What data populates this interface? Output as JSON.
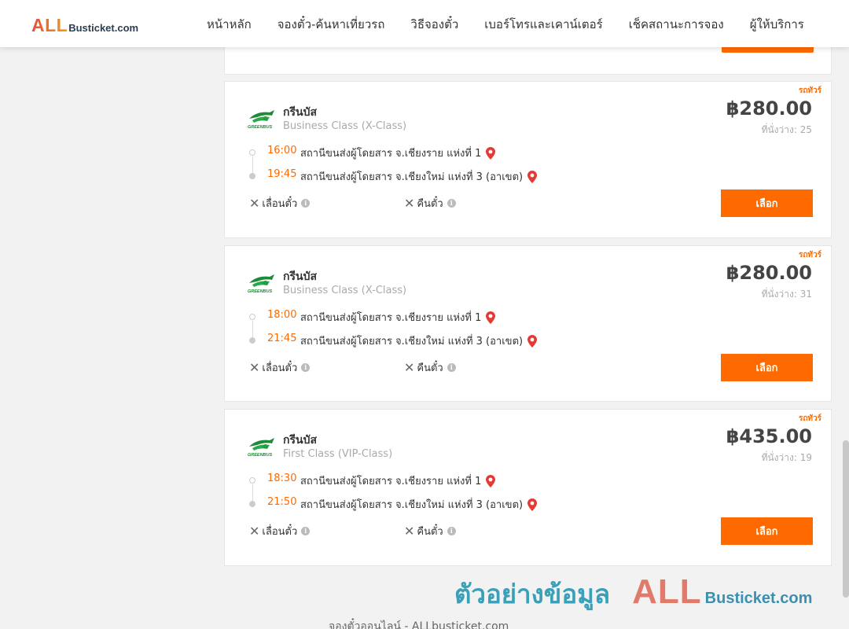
{
  "header": {
    "logo": {
      "all": "ALL",
      "rest": "Busticket.com"
    },
    "nav": [
      "หน้าหลัก",
      "จองตั๋ว-ค้นหาเที่ยวรถ",
      "วิธีจองตั๋ว",
      "เบอร์โทรและเคาน์เตอร์",
      "เช็คสถานะการจอง",
      "ผู้ให้บริการ"
    ]
  },
  "colors": {
    "accent": "#ff6a00",
    "logo_all_gradient": [
      "#e74c3c",
      "#f39c12"
    ],
    "text_muted": "#aaaaaa"
  },
  "trips": [
    {
      "tag": "รถทัวร์",
      "operator": "กรีนบัส",
      "bus_class": "Business Class (X-Class)",
      "price": "฿280.00",
      "seats": "ที่นั่งว่าง: 25",
      "depart_time": "16:00",
      "depart_station": "สถานีขนส่งผู้โดยสาร จ.เชียงราย แห่งที่ 1",
      "arrive_time": "19:45",
      "arrive_station": "สถานีขนส่งผู้โดยสาร จ.เชียงใหม่ แห่งที่ 3 (อาเขต)",
      "reschedule": "เลื่อนตั๋ว",
      "refund": "คืนตั๋ว",
      "select": "เลือก"
    },
    {
      "tag": "รถทัวร์",
      "operator": "กรีนบัส",
      "bus_class": "Business Class (X-Class)",
      "price": "฿280.00",
      "seats": "ที่นั่งว่าง: 31",
      "depart_time": "18:00",
      "depart_station": "สถานีขนส่งผู้โดยสาร จ.เชียงราย แห่งที่ 1",
      "arrive_time": "21:45",
      "arrive_station": "สถานีขนส่งผู้โดยสาร จ.เชียงใหม่ แห่งที่ 3 (อาเขต)",
      "reschedule": "เลื่อนตั๋ว",
      "refund": "คืนตั๋ว",
      "select": "เลือก"
    },
    {
      "tag": "รถทัวร์",
      "operator": "กรีนบัส",
      "bus_class": "First Class (VIP-Class)",
      "price": "฿435.00",
      "seats": "ที่นั่งว่าง: 19",
      "depart_time": "18:30",
      "depart_station": "สถานีขนส่งผู้โดยสาร จ.เชียงราย แห่งที่ 1",
      "arrive_time": "21:50",
      "arrive_station": "สถานีขนส่งผู้โดยสาร จ.เชียงใหม่ แห่งที่ 3 (อาเขต)",
      "reschedule": "เลื่อนตั๋ว",
      "refund": "คืนตั๋ว",
      "select": "เลือก"
    }
  ],
  "watermark": {
    "thai": "ตัวอย่างข้อมูล",
    "all": "ALL",
    "rest": "Busticket.com"
  },
  "footer": "จองตั๋วออนไลน์ - ALLbusticket.com"
}
